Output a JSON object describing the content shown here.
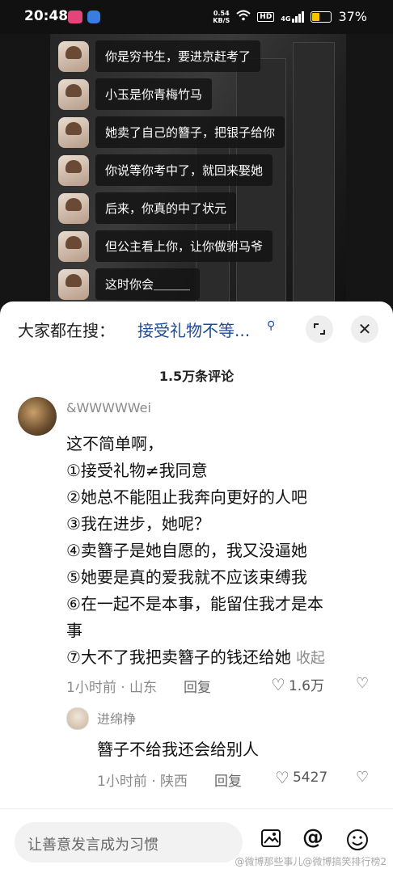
{
  "status_bar": {
    "time": "20:48",
    "net_speed_top": "0.54",
    "net_speed_bottom": "KB/S",
    "hd": "HD",
    "signal": "4G",
    "battery": "37%",
    "battery_level": 0.37
  },
  "video": {
    "messages": [
      "你是穷书生，要进京赶考了",
      "小玉是你青梅竹马",
      "她卖了自己的簪子，把银子给你",
      "你说等你考中了，就回来娶她",
      "后来，你真的中了状元",
      "但公主看上你，让你做驸马爷",
      "这时你会＿＿＿"
    ]
  },
  "search": {
    "label": "大家都在搜：",
    "query": "接受礼物不等..."
  },
  "comments_count": "1.5万条评论",
  "comment": {
    "username": "&WWWWWei",
    "lines": [
      "这不简单啊，",
      "①接受礼物≠我同意",
      "②她总不能阻止我奔向更好的人吧",
      "③我在进步，她呢？",
      "④卖簪子是她自愿的，我又没逼她",
      "⑤她要是真的爱我就不应该束缚我",
      "⑥在一起不是本事，能留住我才是本",
      "事",
      "⑦大不了我把卖簪子的钱还给她"
    ],
    "collapse_label": "收起",
    "meta": "1小时前 · 山东",
    "reply_label": "回复",
    "likes": "1.6万"
  },
  "reply": {
    "username": "进绵棦",
    "text": "簪子不给我还会给别人",
    "meta": "1小时前 · 陕西",
    "reply_label": "回复",
    "likes": "5427"
  },
  "input": {
    "placeholder": "让善意发言成为习惯"
  },
  "watermark": "@微博那些事儿@微博搞笑排行榜2"
}
